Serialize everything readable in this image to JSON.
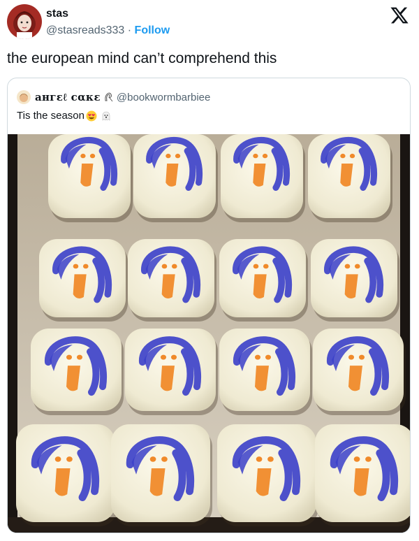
{
  "tweet": {
    "author_name": "stas",
    "author_handle": "@stasreads333",
    "separator": "·",
    "follow_label": "Follow",
    "text": "the european mind can’t comprehend this",
    "platform_icon": "x-logo-icon"
  },
  "quote": {
    "author_name": "ангɛℓ cακɛ",
    "author_handle": "@bookwormbarbiee",
    "text": "Tis the season",
    "emojis": [
      "heart-eyes-emoji",
      "ghost-emoji"
    ]
  },
  "photo": {
    "subject": "ghost-cake-grid",
    "rows": 4,
    "cols": 4,
    "colors": {
      "sponge": "#f4f0dc",
      "ink_blue": "#3b3fc9",
      "ink_orange": "#f08a2a",
      "tray": "#c8bfae",
      "shadow": "#1a1512"
    }
  },
  "colors": {
    "follow": "#1d9bf0",
    "muted": "#536471",
    "text": "#0f1419",
    "border": "#cfd9de"
  }
}
